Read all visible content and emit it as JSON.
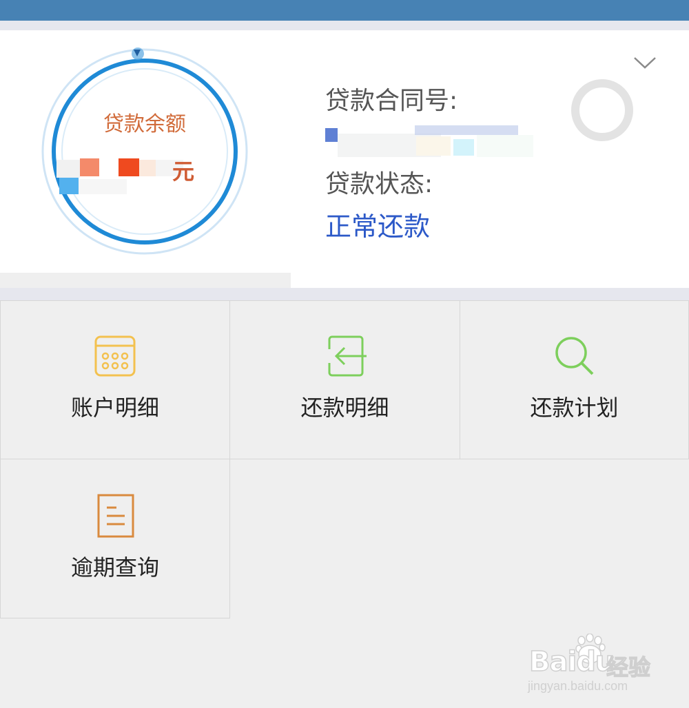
{
  "loan_card": {
    "balance_label": "贷款余额",
    "balance_unit": "元",
    "contract_label": "贷款合同号:",
    "status_label": "贷款状态:",
    "status_value": "正常还款"
  },
  "menu": {
    "items": [
      {
        "label": "账户明细",
        "icon": "calendar-icon",
        "color": "#f3c14f"
      },
      {
        "label": "还款明细",
        "icon": "login-arrow-icon",
        "color": "#7dcf5c"
      },
      {
        "label": "还款计划",
        "icon": "search-icon",
        "color": "#7dcf5c"
      },
      {
        "label": "逾期查询",
        "icon": "document-icon",
        "color": "#d98a3e"
      }
    ]
  },
  "watermark": {
    "brand": "Baidu",
    "brand_cn": "经验",
    "url": "jingyan.baidu.com"
  },
  "colors": {
    "header": "#4782b4",
    "accent_blue": "#2c59c8",
    "balance_label": "#d16b3a",
    "ring": "#1f8ad6"
  }
}
